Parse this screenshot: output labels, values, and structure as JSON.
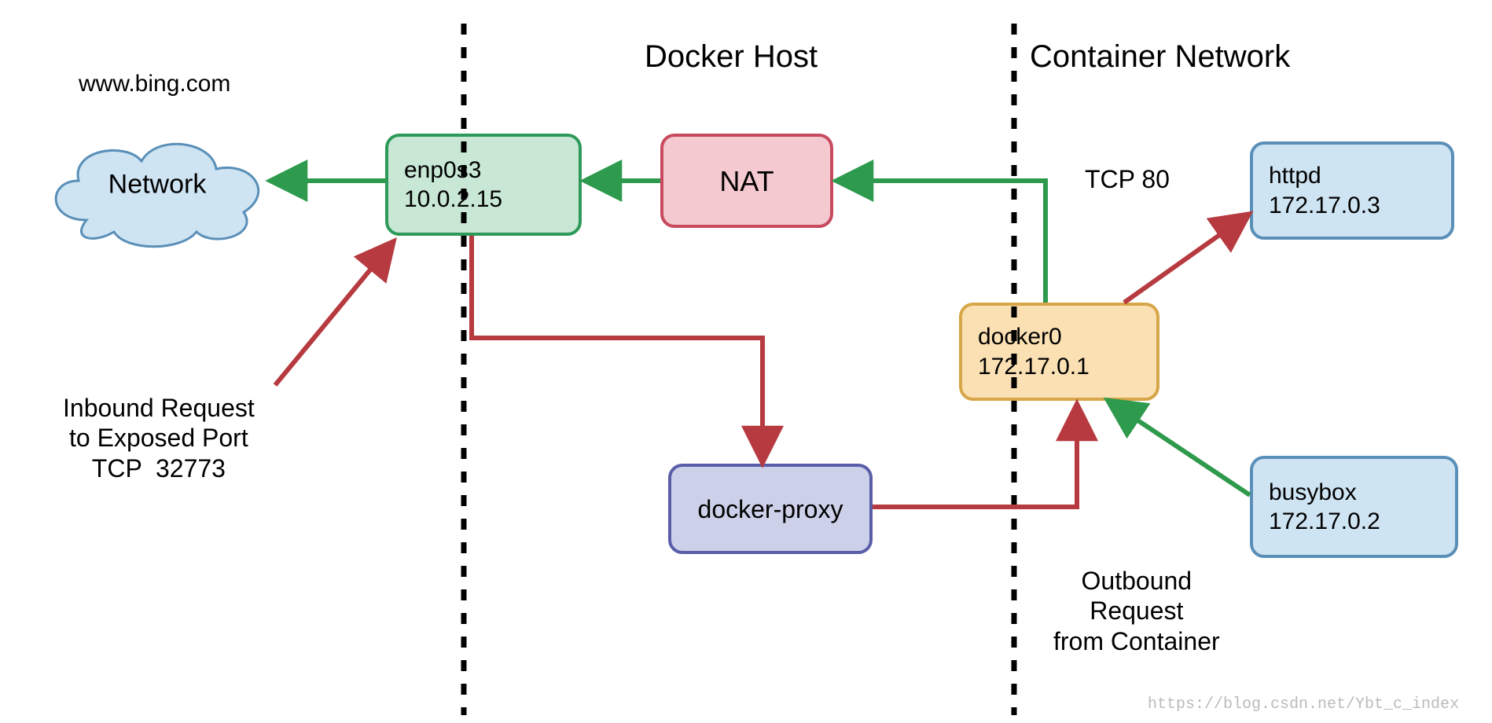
{
  "titles": {
    "docker_host": "Docker Host",
    "container_network": "Container Network"
  },
  "external": {
    "url_label": "www.bing.com",
    "cloud_label": "Network"
  },
  "nodes": {
    "enp0s3": {
      "name": "enp0s3",
      "ip": "10.0.2.15"
    },
    "nat": {
      "name": "NAT"
    },
    "docker_proxy": {
      "name": "docker-proxy"
    },
    "docker0": {
      "name": "docker0",
      "ip": "172.17.0.1"
    },
    "httpd": {
      "name": "httpd",
      "ip": "172.17.0.3"
    },
    "busybox": {
      "name": "busybox",
      "ip": "172.17.0.2"
    }
  },
  "captions": {
    "inbound": "Inbound Request\nto Exposed Port\nTCP  32773",
    "outbound": "Outbound\nRequest\nfrom Container",
    "tcp80": "TCP 80"
  },
  "watermark": "https://blog.csdn.net/Ybt_c_index",
  "colors": {
    "arrow_green": "#2e9a4d",
    "arrow_red": "#b63a3f",
    "dash": "#000000"
  }
}
